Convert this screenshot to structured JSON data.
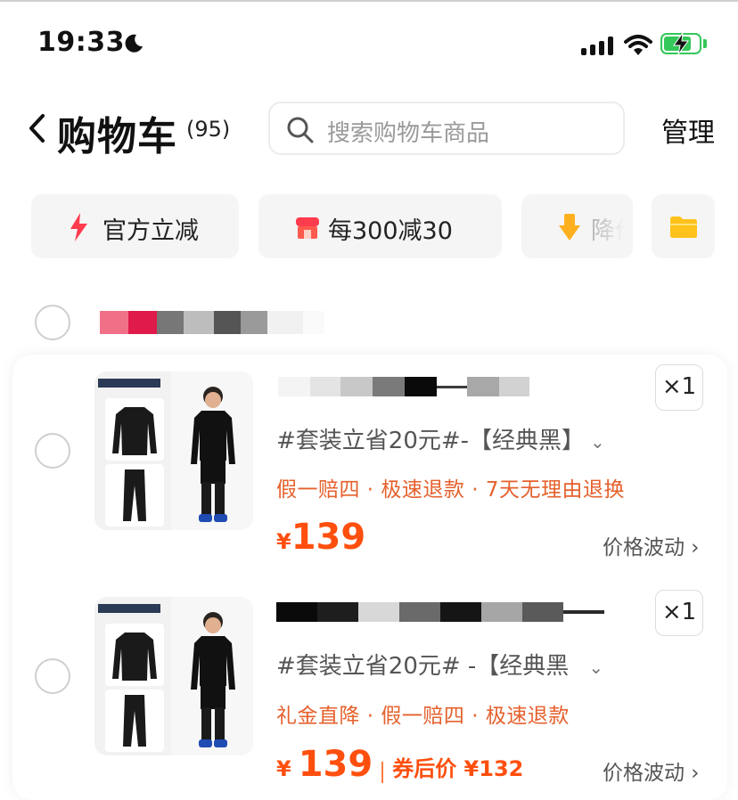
{
  "status_bar": {
    "time": "19:33"
  },
  "header": {
    "title": "购物车",
    "count": "(95)",
    "search_placeholder": "搜索购物车商品",
    "manage_label": "管理"
  },
  "filters": [
    {
      "label": "官方立减",
      "icon": "lightning-icon"
    },
    {
      "label": "每300减30",
      "icon": "store-icon"
    },
    {
      "label": "降价",
      "icon": "arrow-down-icon"
    },
    {
      "icon": "folder-icon"
    }
  ],
  "items": [
    {
      "spec": "#套装立省20元#-【经典黑】",
      "promises": "假一赔四 · 极速退款 · 7天无理由退换",
      "price_symbol": "¥",
      "price": "139",
      "price_fluctuation": "价格波动",
      "quantity": "×1"
    },
    {
      "spec": "#套装立省20元# -【经典黑",
      "promises": "礼金直降 · 假一赔四 · 极速退款",
      "price_symbol": "¥",
      "price": "139",
      "after_coupon": "券后价 ¥132",
      "price_fluctuation": "价格波动",
      "quantity": "×1"
    }
  ],
  "colors": {
    "accent": "#ff4f0e",
    "promise": "#e5612d",
    "battery": "#34c759"
  }
}
